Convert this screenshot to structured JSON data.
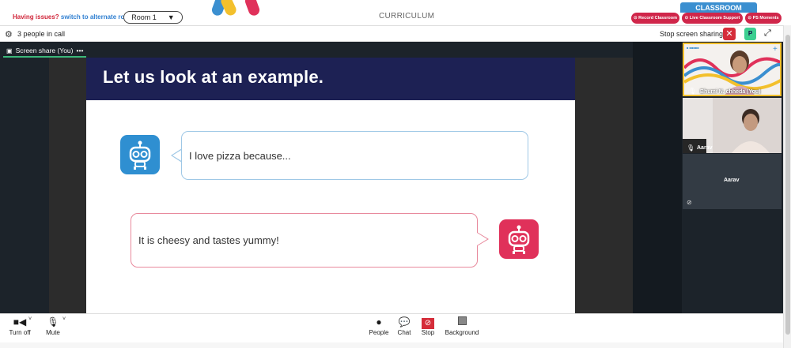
{
  "banner": {
    "issue_q": "Having issues?",
    "issue_link": "switch to alternate room",
    "room": "Room 1",
    "curriculum": "CURRICULUM",
    "classroom_tab": "CLASSROOM",
    "buttons": [
      "Record Classroom",
      "Live Classroom Support",
      "PS Moments"
    ]
  },
  "callbar": {
    "people_count": "3 people in call",
    "stop_sharing": "Stop screen sharing",
    "close": "✕",
    "avatar_initial": "P",
    "expand": "⤢"
  },
  "stage": {
    "share_label": "Screen share (You)",
    "share_menu": "•••",
    "slide": {
      "title": "Let us look at an example.",
      "bubble1": "I love pizza because...",
      "bubble2": "It is cheesy and tastes yummy!"
    }
  },
  "tiles": [
    {
      "name": "Bhumi N. chheda (You)"
    },
    {
      "name": "Aarav"
    },
    {
      "name": "Aarav"
    }
  ],
  "toolbar": {
    "turn_off": "Turn off",
    "mute": "Mute",
    "people": "People",
    "chat": "Chat",
    "stop": "Stop",
    "background": "Background"
  },
  "colors": {
    "slide_header": "#1d2154",
    "robot_blue": "#2f8fd1",
    "robot_pink": "#e0315a",
    "share_accent": "#3bb77a"
  }
}
